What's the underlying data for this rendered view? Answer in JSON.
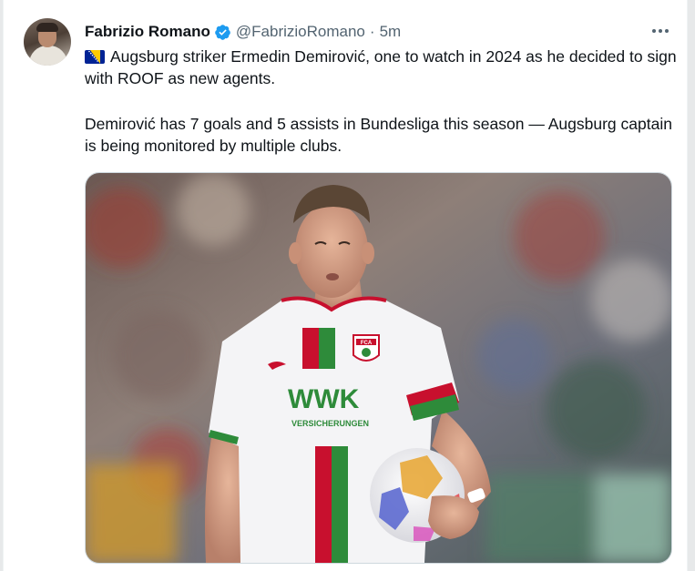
{
  "tweet": {
    "author_name": "Fabrizio Romano",
    "handle": "@FabrizioRomano",
    "separator": "·",
    "time": "5m",
    "paragraph1": "Augsburg striker Ermedin Demirović, one to watch in 2024 as he decided to sign with ROOF as new agents.",
    "paragraph2": "Demirović has 7 goals and 5 assists in Bundesliga this season — Augsburg captain is being monitored by multiple clubs.",
    "flag_icon": "bosnia-flag-icon",
    "verified_icon": "verified-badge-icon",
    "more_icon": "more-options-icon"
  },
  "media": {
    "shirt_sponsor_top": "WWK",
    "shirt_sponsor_bottom": "VERSICHERUNGEN",
    "club_badge_text": "FCA"
  },
  "colors": {
    "verified_blue": "#1d9bf0",
    "text_primary": "#0f1419",
    "text_secondary": "#536471",
    "augsburg_red": "#c8102e",
    "augsburg_green": "#2e8b3a"
  }
}
